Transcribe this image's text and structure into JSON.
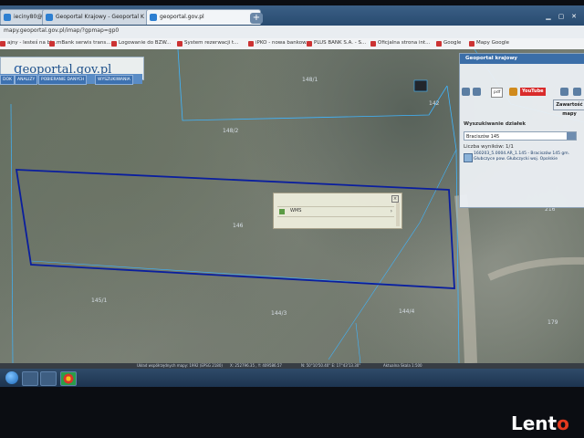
{
  "browser": {
    "tabs": [
      {
        "label": "ieciny80@gm",
        "active": false
      },
      {
        "label": "Geoportal Krajowy - Geoportal K",
        "active": false
      },
      {
        "label": "geoportal.gov.pl",
        "active": true
      }
    ],
    "new_tab": "+",
    "url": "mapy.geoportal.gov.pl/imap/?gpmap=gp0",
    "bookmarks": [
      "ajny - lesteś na bl...",
      "mBank serwis trans...",
      "Logowanie do BZW...",
      "System rezerwacji t...",
      "iPKO - nowa bankow...",
      "PLUS BANK S.A. - S...",
      "Oficjalna strona int...",
      "Google",
      "Mapy Google"
    ]
  },
  "geoportal": {
    "logo": "eoportal.gov.pl",
    "logo_g": "g",
    "menu": [
      "DOK",
      "ANALIZY",
      "POBIERANIE DANYCH",
      "WYSZUKIWANIA"
    ]
  },
  "panel": {
    "header": "Geoportal krajowy",
    "toolbar_pill": "pdf",
    "youtube": "YouTube",
    "zoom_button": "Zawartość mapy",
    "search_title": "Wyszukiwanie działek",
    "search_value": "Braciszów 145",
    "count_label": "Liczba wyników:",
    "count_value": "1/1",
    "result": "160203_5.0004.AR_1.145 - Braciszów 145 gm. Głubczyce pow. Głubczycki woj. Opolskie"
  },
  "popup": {
    "label": "WMS",
    "arrow": "›"
  },
  "parcels": {
    "a": "148/1",
    "b": "148/2",
    "c": "146",
    "d": "144/3",
    "e": "144/4",
    "f": "142",
    "g": "179",
    "h": "216",
    "i": "145/1"
  },
  "statusbar": {
    "a": "Układ współrzędnych mapy: 1992 (EPSG 2180)",
    "b": "X: 252796.35 , Y: 409586.57",
    "c": "N: 50°10'50.40\" E: 17°43'13.30\"",
    "d": "Aktualna Skala 1:500"
  },
  "watermark": {
    "text": "Lent",
    "o": "o"
  }
}
